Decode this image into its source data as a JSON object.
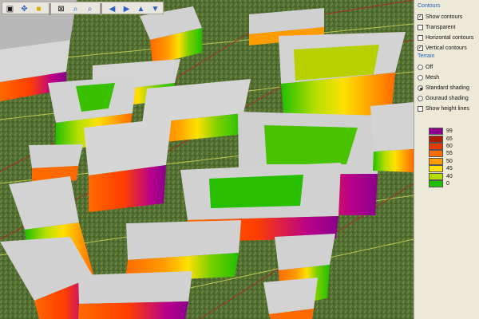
{
  "toolbar": {
    "buttons": [
      {
        "name": "select-tool",
        "icon": "square-icon"
      },
      {
        "name": "pan-tool",
        "icon": "pan-icon"
      },
      {
        "name": "highlight-tool",
        "icon": "yellow-box-icon"
      },
      {
        "name": "target-tool",
        "icon": "target-icon"
      },
      {
        "name": "zoom-in-tool",
        "icon": "zoom-in-icon"
      },
      {
        "name": "zoom-out-tool",
        "icon": "zoom-out-icon"
      },
      {
        "name": "left-arrow-tool",
        "icon": "arrow-left-icon"
      },
      {
        "name": "right-arrow-tool",
        "icon": "arrow-right-icon"
      },
      {
        "name": "up-arrow-tool",
        "icon": "arrow-up-icon"
      },
      {
        "name": "down-arrow-tool",
        "icon": "arrow-down-icon"
      }
    ]
  },
  "panel": {
    "contours_title": "Contours",
    "contours": [
      {
        "label": "Show contours",
        "checked": true
      },
      {
        "label": "Transparent",
        "checked": false
      },
      {
        "label": "Horizontal contours",
        "checked": false
      },
      {
        "label": "Vertical contours",
        "checked": true
      }
    ],
    "terrain_title": "Terrain",
    "terrain_options": [
      {
        "label": "Off",
        "selected": false
      },
      {
        "label": "Mesh",
        "selected": false
      },
      {
        "label": "Standard shading",
        "selected": true
      },
      {
        "label": "Gouraud shading",
        "selected": false
      }
    ],
    "show_height_lines": {
      "label": "Show height lines",
      "checked": false
    },
    "legend": [
      {
        "value": "99",
        "color": "#8a008a"
      },
      {
        "value": "65",
        "color": "#aa1e00"
      },
      {
        "value": "60",
        "color": "#e33a00"
      },
      {
        "value": "55",
        "color": "#ff6a00"
      },
      {
        "value": "50",
        "color": "#ff9d00"
      },
      {
        "value": "45",
        "color": "#ffe000"
      },
      {
        "value": "40",
        "color": "#b5df00"
      },
      {
        "value": "0",
        "color": "#1fbf00"
      }
    ]
  }
}
